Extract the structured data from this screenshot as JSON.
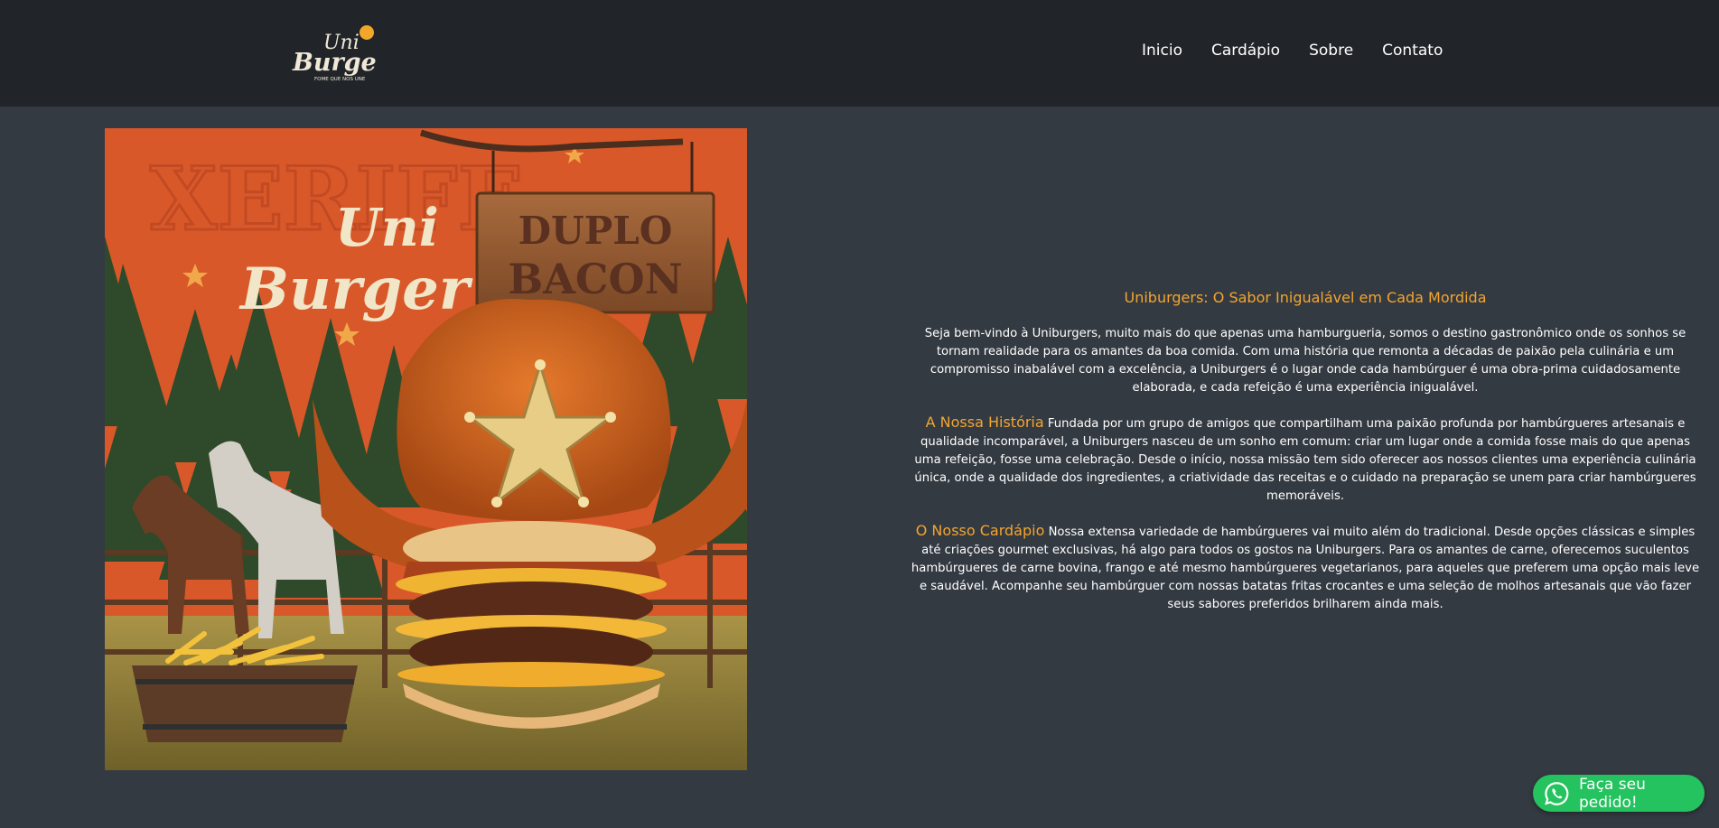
{
  "brand": {
    "logo_line1": "Uni",
    "logo_line2": "Burger",
    "tagline": "FOME QUE NOS UNE"
  },
  "nav": {
    "items": [
      "Inicio",
      "Cardápio",
      "Sobre",
      "Contato"
    ]
  },
  "poster": {
    "bg_word": "XERIFE",
    "logo_line1": "Uni",
    "logo_line2": "Burger",
    "sign_line1": "DUPLO",
    "sign_line2": "BACON"
  },
  "content": {
    "title": "Uniburgers: O Sabor Inigualável em Cada Mordida",
    "intro": "Seja bem-vindo à Uniburgers, muito mais do que apenas uma hamburgueria, somos o destino gastronômico onde os sonhos se tornam realidade para os amantes da boa comida. Com uma história que remonta a décadas de paixão pela culinária e um compromisso inabalável com a excelência, a Uniburgers é o lugar onde cada hambúrguer é uma obra-prima cuidadosamente elaborada, e cada refeição é uma experiência inigualável.",
    "history_heading": "A Nossa História",
    "history_text": "Fundada por um grupo de amigos que compartilham uma paixão profunda por hambúrgueres artesanais e qualidade incomparável, a Uniburgers nasceu de um sonho em comum: criar um lugar onde a comida fosse mais do que apenas uma refeição, fosse uma celebração. Desde o início, nossa missão tem sido oferecer aos nossos clientes uma experiência culinária única, onde a qualidade dos ingredientes, a criatividade das receitas e o cuidado na preparação se unem para criar hambúrgueres memoráveis.",
    "menu_heading": "O Nosso Cardápio",
    "menu_text": "Nossa extensa variedade de hambúrgueres vai muito além do tradicional. Desde opções clássicas e simples até criações gourmet exclusivas, há algo para todos os gostos na Uniburgers. Para os amantes de carne, oferecemos suculentos hambúrgueres de carne bovina, frango e até mesmo hambúrgueres vegetarianos, para aqueles que preferem uma opção mais leve e saudável. Acompanhe seu hambúrguer com nossas batatas fritas crocantes e uma seleção de molhos artesanais que vão fazer seus sabores preferidos brilharem ainda mais."
  },
  "whatsapp": {
    "label": "Faça seu pedido!",
    "icon": "whatsapp-icon"
  },
  "colors": {
    "page_bg": "#343a42",
    "header_bg": "#212529",
    "accent": "#f4a52e",
    "whatsapp": "#25c35f"
  }
}
